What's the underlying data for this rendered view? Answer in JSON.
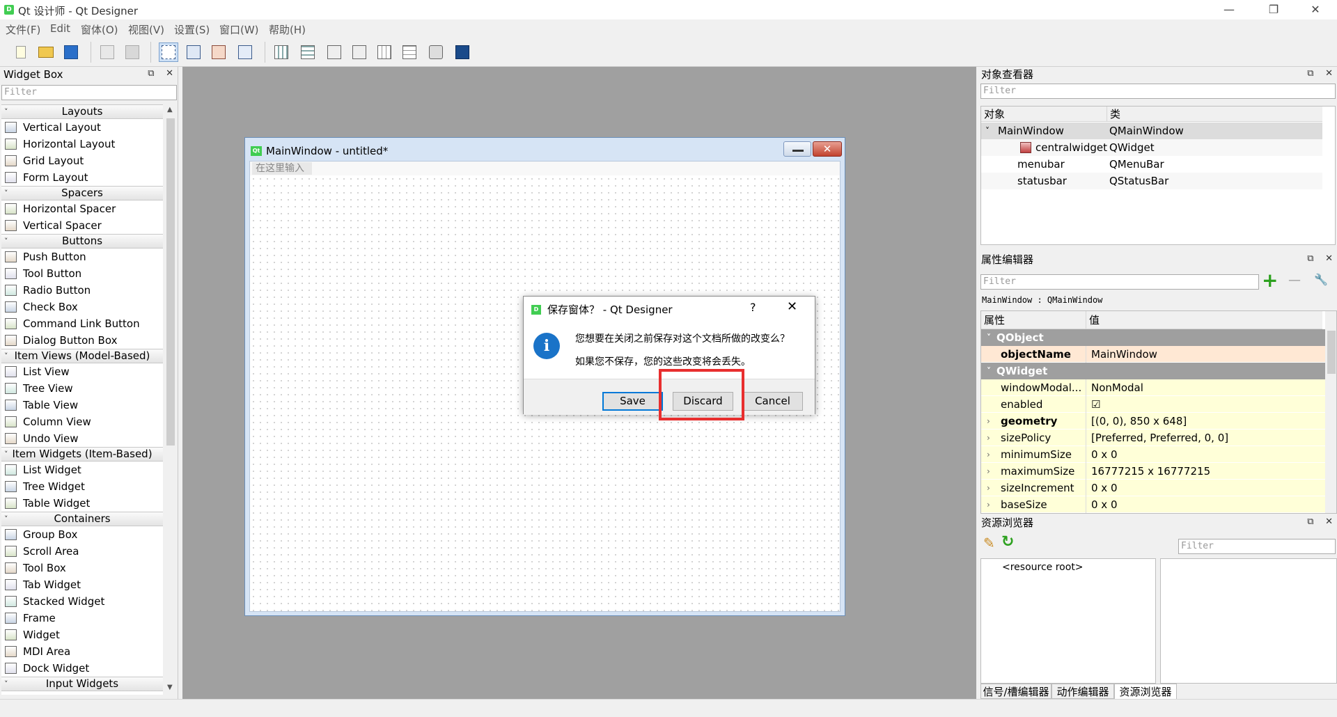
{
  "app": {
    "icon_text": "D",
    "title": "Qt 设计师 - Qt Designer",
    "win_min": "—",
    "win_restore": "❐",
    "win_close": "✕"
  },
  "menu": [
    "文件(F)",
    "Edit",
    "窗体(O)",
    "视图(V)",
    "设置(S)",
    "窗口(W)",
    "帮助(H)"
  ],
  "toolbar": {
    "icons": [
      "new-file-icon",
      "open-folder-icon",
      "save-icon",
      "send-to-back-icon",
      "bring-to-front-icon",
      "edit-widgets-icon",
      "edit-signals-slots-icon",
      "edit-buddies-icon",
      "edit-tab-order-icon",
      "layout-horizontal-icon",
      "layout-vertical-icon",
      "layout-horizontal-splitter-icon",
      "layout-vertical-splitter-icon",
      "layout-grid-icon",
      "layout-form-icon",
      "break-layout-icon",
      "adjust-size-icon"
    ]
  },
  "widget_box": {
    "title": "Widget Box",
    "filter_placeholder": "Filter",
    "float_glyph": "⧉",
    "close_glyph": "✕",
    "scroll_up": "▲",
    "scroll_down": "▼",
    "chevron": "˅",
    "categories": [
      {
        "name": "Layouts",
        "items": [
          "Vertical Layout",
          "Horizontal Layout",
          "Grid Layout",
          "Form Layout"
        ]
      },
      {
        "name": "Spacers",
        "items": [
          "Horizontal Spacer",
          "Vertical Spacer"
        ]
      },
      {
        "name": "Buttons",
        "items": [
          "Push Button",
          "Tool Button",
          "Radio Button",
          "Check Box",
          "Command Link Button",
          "Dialog Button Box"
        ]
      },
      {
        "name": "Item Views (Model-Based)",
        "items": [
          "List View",
          "Tree View",
          "Table View",
          "Column View",
          "Undo View"
        ]
      },
      {
        "name": "Item Widgets (Item-Based)",
        "items": [
          "List Widget",
          "Tree Widget",
          "Table Widget"
        ]
      },
      {
        "name": "Containers",
        "items": [
          "Group Box",
          "Scroll Area",
          "Tool Box",
          "Tab Widget",
          "Stacked Widget",
          "Frame",
          "Widget",
          "MDI Area",
          "Dock Widget"
        ]
      },
      {
        "name": "Input Widgets",
        "items": []
      }
    ]
  },
  "form_window": {
    "icon_text": "Qt",
    "title": "MainWindow - untitled*",
    "menu_placeholder": "在这里输入",
    "close_glyph": "✕"
  },
  "dialog": {
    "icon_text": "D",
    "title": "保存窗体？ - Qt Designer",
    "help": "?",
    "close": "✕",
    "info_glyph": "i",
    "message1": "您想要在关闭之前保存对这个文档所做的改变么？",
    "message2": "如果您不保存，您的这些改变将会丢失。",
    "save_label": "Save",
    "discard_label": "Discard",
    "cancel_label": "Cancel",
    "highlight_color": "#e82e2e"
  },
  "object_inspector": {
    "title": "对象查看器",
    "filter_placeholder": "Filter",
    "col_object": "对象",
    "col_class": "类",
    "rows": [
      {
        "name": "MainWindow",
        "cls": "QMainWindow",
        "expand": "˅"
      },
      {
        "name": "centralwidget",
        "cls": "QWidget",
        "expand": ""
      },
      {
        "name": "menubar",
        "cls": "QMenuBar",
        "expand": ""
      },
      {
        "name": "statusbar",
        "cls": "QStatusBar",
        "expand": ""
      }
    ]
  },
  "property_editor": {
    "title": "属性编辑器",
    "filter_placeholder": "Filter",
    "add_glyph": "+",
    "remove_glyph": "—",
    "tool_glyph": "🔧",
    "context": "MainWindow : QMainWindow",
    "col_property": "属性",
    "col_value": "值",
    "rows": [
      {
        "type": "group",
        "name": "QObject",
        "expand": "˅"
      },
      {
        "type": "prop",
        "name": "objectName",
        "value": "MainWindow",
        "bold": true,
        "pink": true,
        "expand": ""
      },
      {
        "type": "group",
        "name": "QWidget",
        "expand": "˅"
      },
      {
        "type": "prop",
        "name": "windowModal...",
        "value": "NonModal",
        "bold": false,
        "pink": false,
        "expand": ""
      },
      {
        "type": "prop",
        "name": "enabled",
        "value": "☑",
        "bold": false,
        "pink": false,
        "expand": ""
      },
      {
        "type": "prop",
        "name": "geometry",
        "value": "[(0, 0), 850 x 648]",
        "bold": true,
        "pink": false,
        "expand": "›"
      },
      {
        "type": "prop",
        "name": "sizePolicy",
        "value": "[Preferred, Preferred, 0, 0]",
        "bold": false,
        "pink": false,
        "expand": "›"
      },
      {
        "type": "prop",
        "name": "minimumSize",
        "value": "0 x 0",
        "bold": false,
        "pink": false,
        "expand": "›"
      },
      {
        "type": "prop",
        "name": "maximumSize",
        "value": "16777215 x 16777215",
        "bold": false,
        "pink": false,
        "expand": "›"
      },
      {
        "type": "prop",
        "name": "sizeIncrement",
        "value": "0 x 0",
        "bold": false,
        "pink": false,
        "expand": "›"
      },
      {
        "type": "prop",
        "name": "baseSize",
        "value": "0 x 0",
        "bold": false,
        "pink": false,
        "expand": "›"
      }
    ]
  },
  "resource_browser": {
    "title": "资源浏览器",
    "filter_placeholder": "Filter",
    "root": "<resource root>",
    "edit_glyph": "✎",
    "reload_glyph": "↻"
  },
  "bottom_tabs": [
    "信号/槽编辑器",
    "动作编辑器",
    "资源浏览器"
  ]
}
